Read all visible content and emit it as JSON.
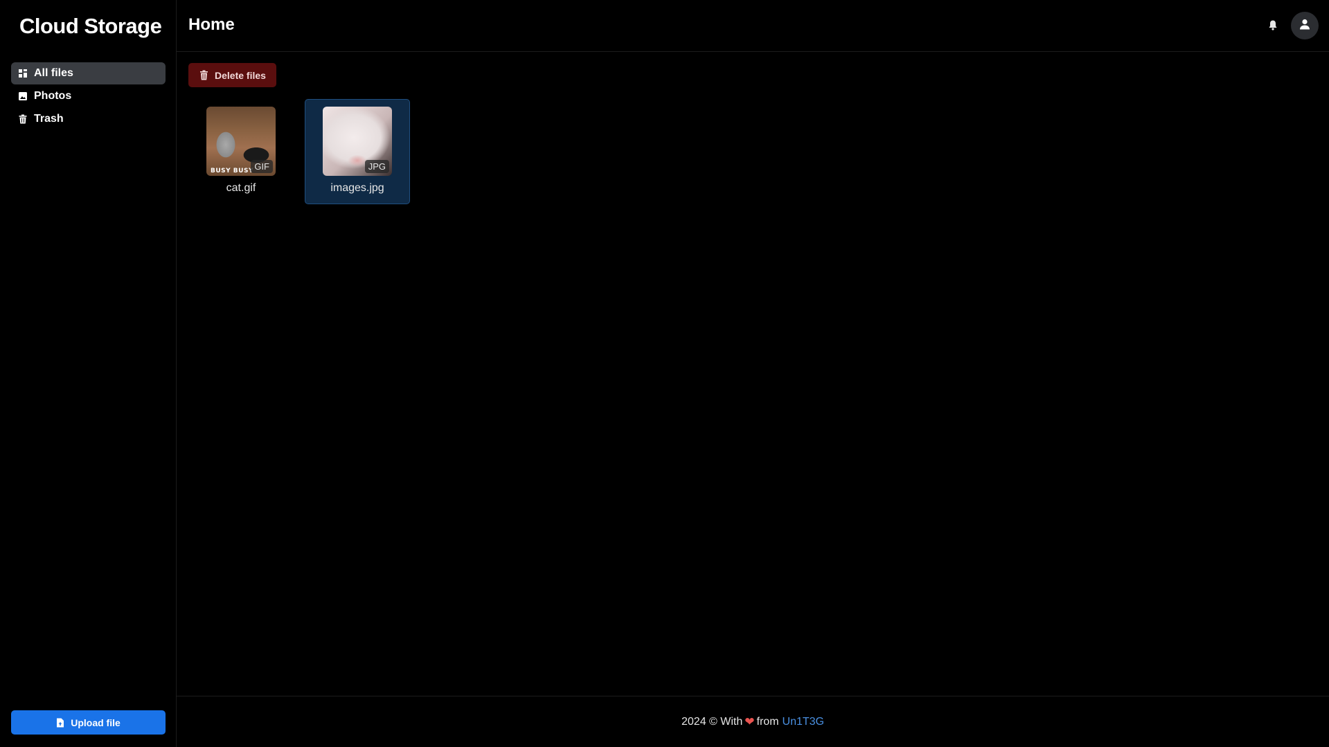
{
  "sidebar": {
    "brand": "Cloud Storage",
    "items": [
      {
        "label": "All files",
        "icon": "grid-icon",
        "active": true
      },
      {
        "label": "Photos",
        "icon": "image-icon",
        "active": false
      },
      {
        "label": "Trash",
        "icon": "trash-icon",
        "active": false
      }
    ],
    "upload_label": "Upload file"
  },
  "header": {
    "title": "Home"
  },
  "toolbar": {
    "delete_label": "Delete files"
  },
  "files": [
    {
      "name": "cat.gif",
      "type": "GIF",
      "caption": "BUSY BUSY",
      "selected": false
    },
    {
      "name": "images.jpg",
      "type": "JPG",
      "selected": true
    }
  ],
  "footer": {
    "prefix": "2024 © With",
    "middle": "from",
    "author": "Un1T3G",
    "heart": "❤"
  },
  "colors": {
    "accent": "#1a73e8",
    "danger": "#5a0e0e",
    "selected": "#0f2a46",
    "link": "#4a90e2"
  }
}
